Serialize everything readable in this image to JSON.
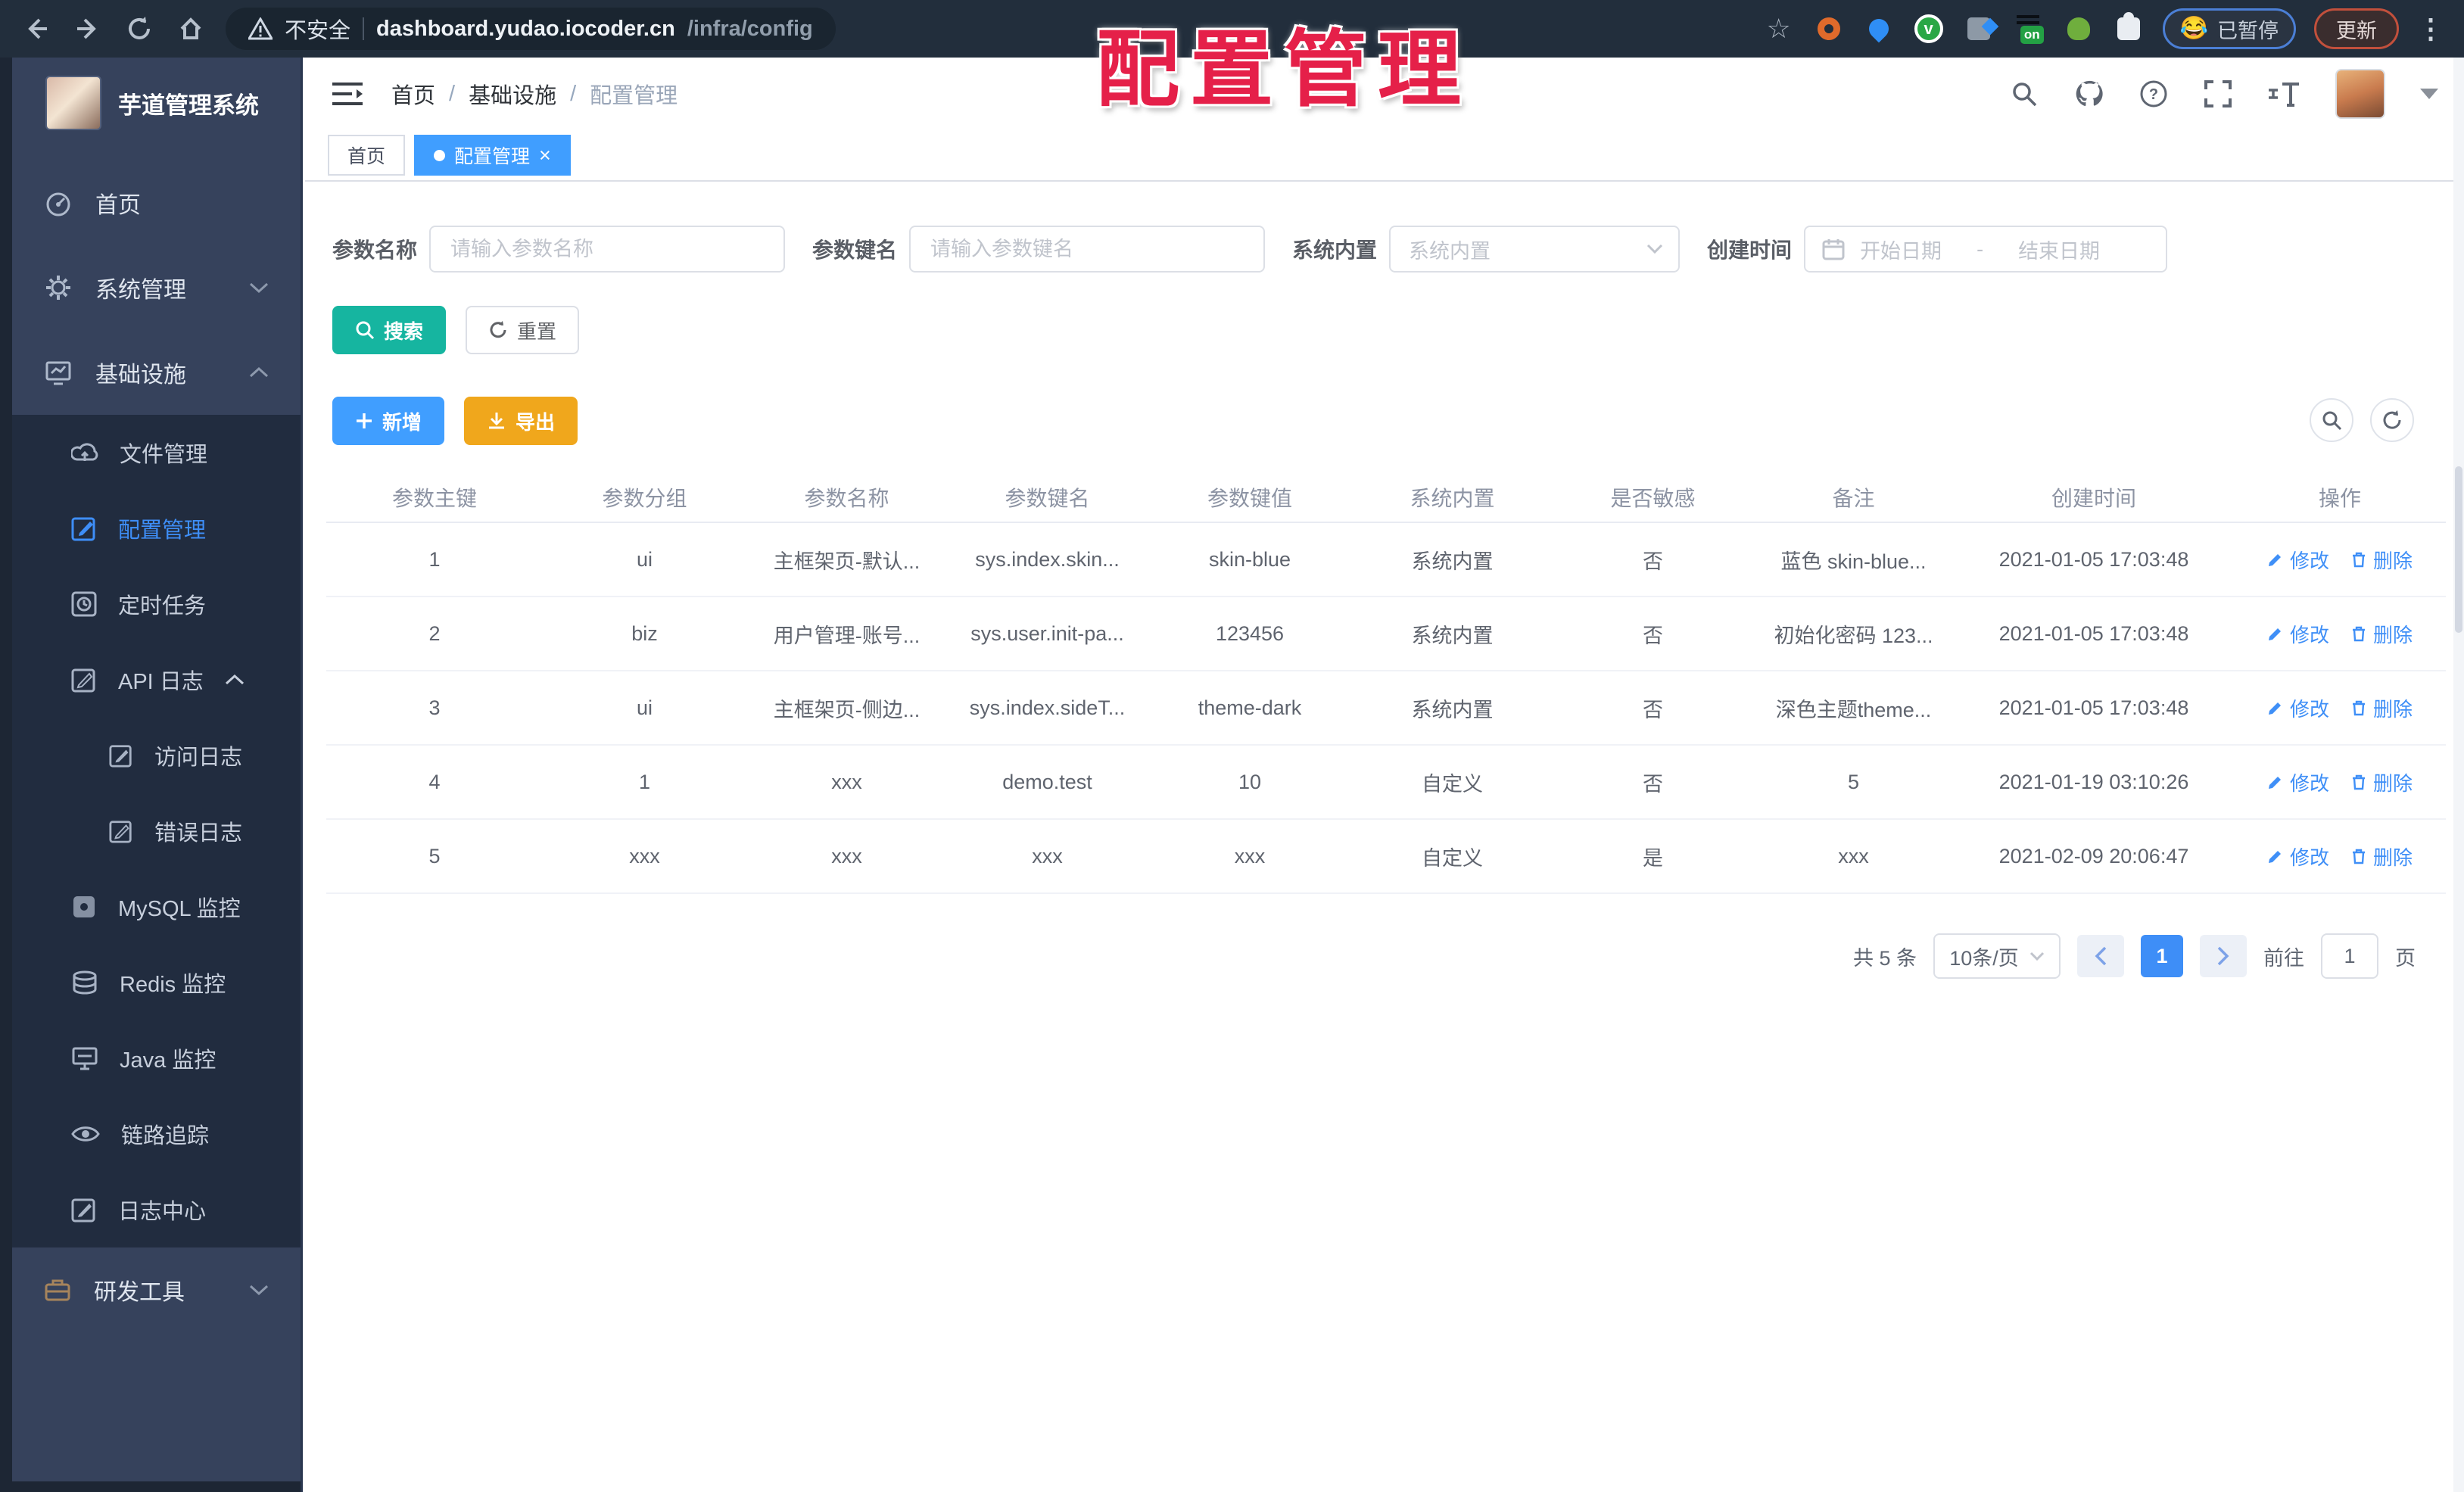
{
  "watermark": "配置管理",
  "browser": {
    "security_label": "不安全",
    "url_host": "dashboard.yudao.iocoder.cn",
    "url_path": "/infra/config",
    "on_badge": "on",
    "circle_v": "v",
    "paused_label": "已暂停",
    "paused_emoji": "😂",
    "update_label": "更新",
    "kebab": "⋮",
    "star": "☆"
  },
  "sidebar": {
    "title": "芋道管理系统",
    "items": [
      {
        "label": "首页"
      },
      {
        "label": "系统管理"
      },
      {
        "label": "基础设施"
      },
      {
        "label": "文件管理"
      },
      {
        "label": "配置管理"
      },
      {
        "label": "定时任务"
      },
      {
        "label": "API 日志"
      },
      {
        "label": "访问日志"
      },
      {
        "label": "错误日志"
      },
      {
        "label": "MySQL 监控"
      },
      {
        "label": "Redis 监控"
      },
      {
        "label": "Java 监控"
      },
      {
        "label": "链路追踪"
      },
      {
        "label": "日志中心"
      },
      {
        "label": "研发工具"
      }
    ]
  },
  "header": {
    "breadcrumb": {
      "home": "首页",
      "sep1": "/",
      "group": "基础设施",
      "sep2": "/",
      "current": "配置管理"
    }
  },
  "tabs": {
    "home": "首页",
    "current": "配置管理",
    "close": "×"
  },
  "filters": {
    "name_label": "参数名称",
    "name_placeholder": "请输入参数名称",
    "key_label": "参数键名",
    "key_placeholder": "请输入参数键名",
    "type_label": "系统内置",
    "type_placeholder": "系统内置",
    "date_label": "创建时间",
    "date_start": "开始日期",
    "date_sep": "-",
    "date_end": "结束日期",
    "search_label": "搜索",
    "reset_label": "重置",
    "add_label": "新增",
    "export_label": "导出"
  },
  "table": {
    "columns": [
      "参数主键",
      "参数分组",
      "参数名称",
      "参数键名",
      "参数键值",
      "系统内置",
      "是否敏感",
      "备注",
      "创建时间",
      "操作"
    ],
    "edit_label": "修改",
    "delete_label": "删除",
    "rows": [
      [
        "1",
        "ui",
        "主框架页-默认...",
        "sys.index.skin...",
        "skin-blue",
        "系统内置",
        "否",
        "蓝色 skin-blue...",
        "2021-01-05 17:03:48"
      ],
      [
        "2",
        "biz",
        "用户管理-账号...",
        "sys.user.init-pa...",
        "123456",
        "系统内置",
        "否",
        "初始化密码 123...",
        "2021-01-05 17:03:48"
      ],
      [
        "3",
        "ui",
        "主框架页-侧边...",
        "sys.index.sideT...",
        "theme-dark",
        "系统内置",
        "否",
        "深色主题theme...",
        "2021-01-05 17:03:48"
      ],
      [
        "4",
        "1",
        "xxx",
        "demo.test",
        "10",
        "自定义",
        "否",
        "5",
        "2021-01-19 03:10:26"
      ],
      [
        "5",
        "xxx",
        "xxx",
        "xxx",
        "xxx",
        "自定义",
        "是",
        "xxx",
        "2021-02-09 20:06:47"
      ]
    ]
  },
  "pagination": {
    "total": "共 5 条",
    "page_size": "10条/页",
    "current_page": "1",
    "goto_label": "前往",
    "goto_value": "1",
    "page_unit": "页"
  }
}
